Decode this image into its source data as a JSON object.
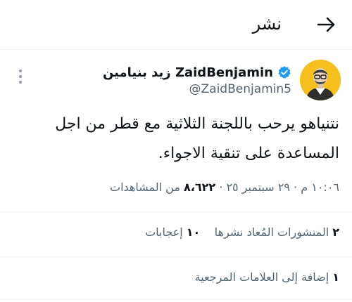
{
  "header": {
    "title": "نشر"
  },
  "tweet": {
    "display_name": "ZaidBenjamin زيد بنيامين",
    "handle": "@ZaidBenjamin5",
    "text": "نتنياهو يرحب باللجنة الثلاثية مع قطر من اجل المساعدة على تنقية الاجواء.",
    "time": "١٠:٠٦ م",
    "date": "٢٩ سبتمبر ٢٥",
    "views_count": "٨،٦٢٢",
    "views_label": "من المشاهدات",
    "separator": "·",
    "reposts_count": "٢",
    "reposts_label": "المنشورات المُعاد نشرها",
    "likes_count": "١٠",
    "likes_label": "إعجابات",
    "bookmarks_count": "١",
    "bookmarks_label": "إضافة إلى العلامات المرجعية"
  },
  "colors": {
    "verified": "#1d9bf0",
    "avatar_bg": "#f5bf1e",
    "secondary_text": "#536471"
  },
  "icons": {
    "back": "arrow-right-icon",
    "verified": "verified-badge-icon",
    "more": "more-vertical-icon"
  }
}
